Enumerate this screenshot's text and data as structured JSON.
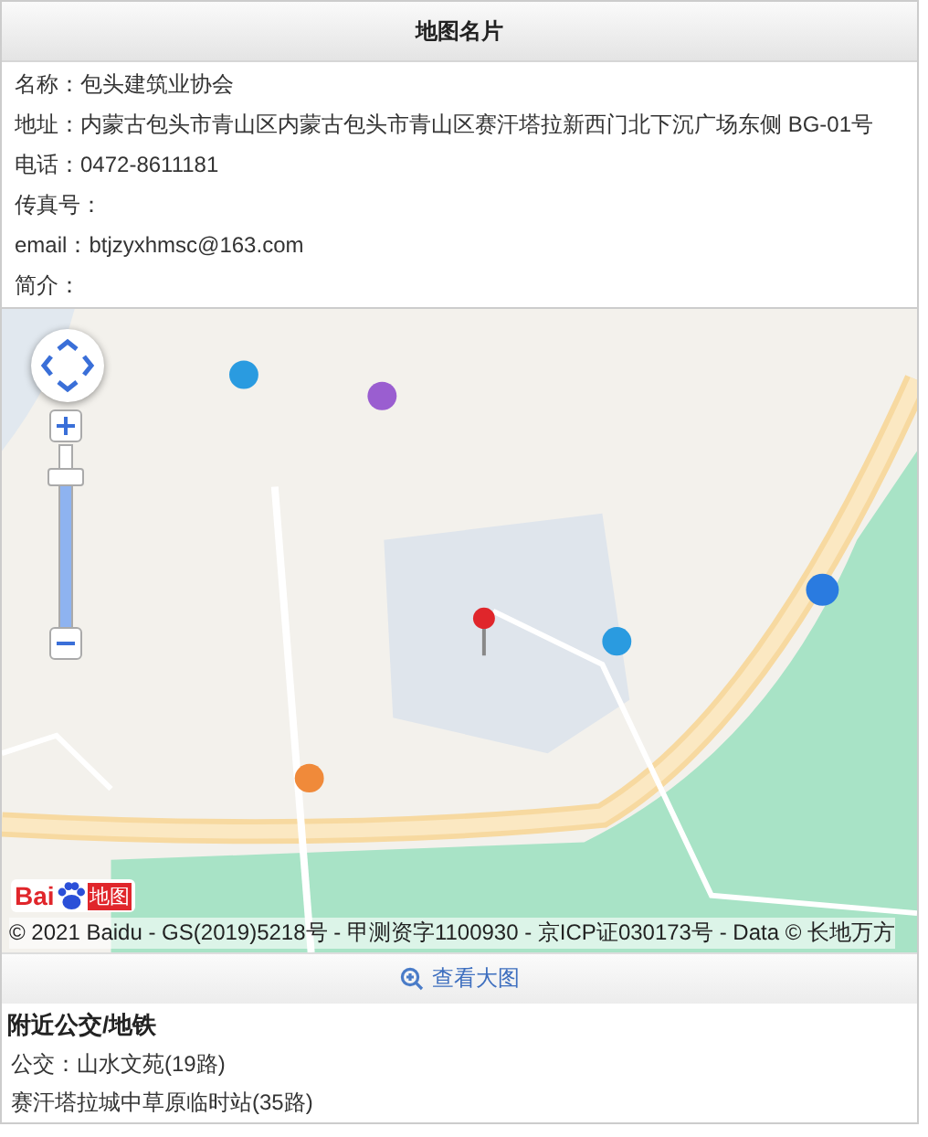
{
  "header": {
    "title": "地图名片"
  },
  "info": [
    {
      "label": "名称：",
      "value": "包头建筑业协会"
    },
    {
      "label": "地址：",
      "value": "内蒙古包头市青山区内蒙古包头市青山区赛汗塔拉新西门北下沉广场东侧 BG-01号"
    },
    {
      "label": "电话：",
      "value": "0472-8611181"
    },
    {
      "label": "传真号："
    },
    {
      "label": "email：",
      "value": "btjzyxhmsc@163.com"
    },
    {
      "label": "简介："
    }
  ],
  "map": {
    "zoom": {
      "level": 0.88
    },
    "logo": {
      "brand": "Bai",
      "product": "地图"
    },
    "copyright": "© 2021 Baidu - GS(2019)5218号 - 甲测资字1100930 - 京ICP证030173号 - Data © 长地万方"
  },
  "view_larger": "查看大图",
  "nearby": {
    "title": "附近公交/地铁",
    "lines": [
      "公交：山水文苑(19路)",
      "赛汗塔拉城中草原临时站(35路)"
    ]
  }
}
